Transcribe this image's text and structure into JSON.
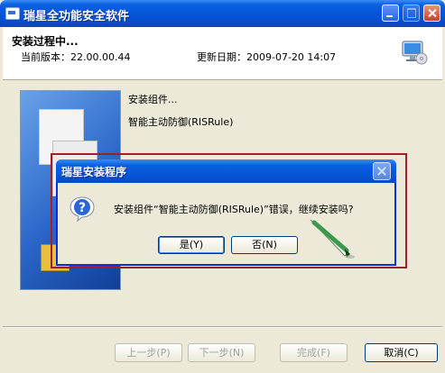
{
  "window": {
    "title": "瑞星全功能安全软件"
  },
  "header": {
    "title": "安装过程中...",
    "version_text": "当前版本：22.00.00.44",
    "date_text": "更新日期：2009-07-20 14:07",
    "icon": "monitor-cd-icon"
  },
  "status": {
    "line1": "安装组件...",
    "line2": "智能主动防御(RISRule)"
  },
  "buttons": {
    "back": "上一步(P)",
    "next": "下一步(N)",
    "finish": "完成(F)",
    "cancel": "取消(C)"
  },
  "dialog": {
    "title": "瑞星安装程序",
    "message": "安装组件“智能主动防御(RISRule)”错误，继续安装吗?",
    "yes": "是(Y)",
    "no": "否(N)",
    "icon": "question-icon"
  },
  "colors": {
    "titlebar": "#0554d6",
    "dialog_frame": "#a0202a",
    "face": "#ece9d8"
  }
}
